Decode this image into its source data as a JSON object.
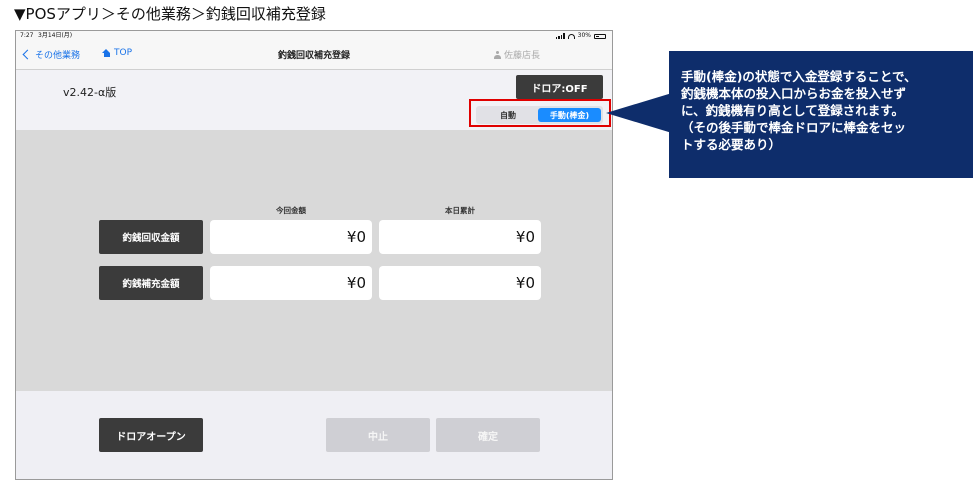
{
  "doc_title": "▼POSアプリ＞その他業務＞釣銭回収補充登録",
  "status_bar": {
    "time": "7:27",
    "date": "3月14日(月)",
    "battery": "30%"
  },
  "nav": {
    "back_label": "その他業務",
    "top_label": "TOP",
    "title": "釣銭回収補充登録",
    "user": "佐藤店長"
  },
  "version": "v2.42-α版",
  "drawer_button": "ドロア:OFF",
  "mode_toggle": {
    "options": [
      "自動",
      "手動(棒金)"
    ],
    "selected": "手動(棒金)"
  },
  "columns": [
    "今回金額",
    "本日累計"
  ],
  "rows": [
    {
      "label": "釣銭回収金額",
      "current": "¥0",
      "total": "¥0"
    },
    {
      "label": "釣銭補充金額",
      "current": "¥0",
      "total": "¥0"
    }
  ],
  "footer_buttons": {
    "open": "ドロアオープン",
    "cancel": "中止",
    "confirm": "確定"
  },
  "callout": {
    "lines": [
      "手動(棒金)の状態で入金登録することで、",
      "釣銭機本体の投入口からお金を投入せず",
      "に、釣銭機有り高として登録されます。",
      "（その後手動で棒金ドロアに棒金をセッ",
      "トする必要あり）"
    ]
  },
  "colors": {
    "accent": "#1a8cff",
    "callout_bg": "#0e2d6b",
    "highlight": "#e00000",
    "dark_button": "#3b3b3b"
  }
}
